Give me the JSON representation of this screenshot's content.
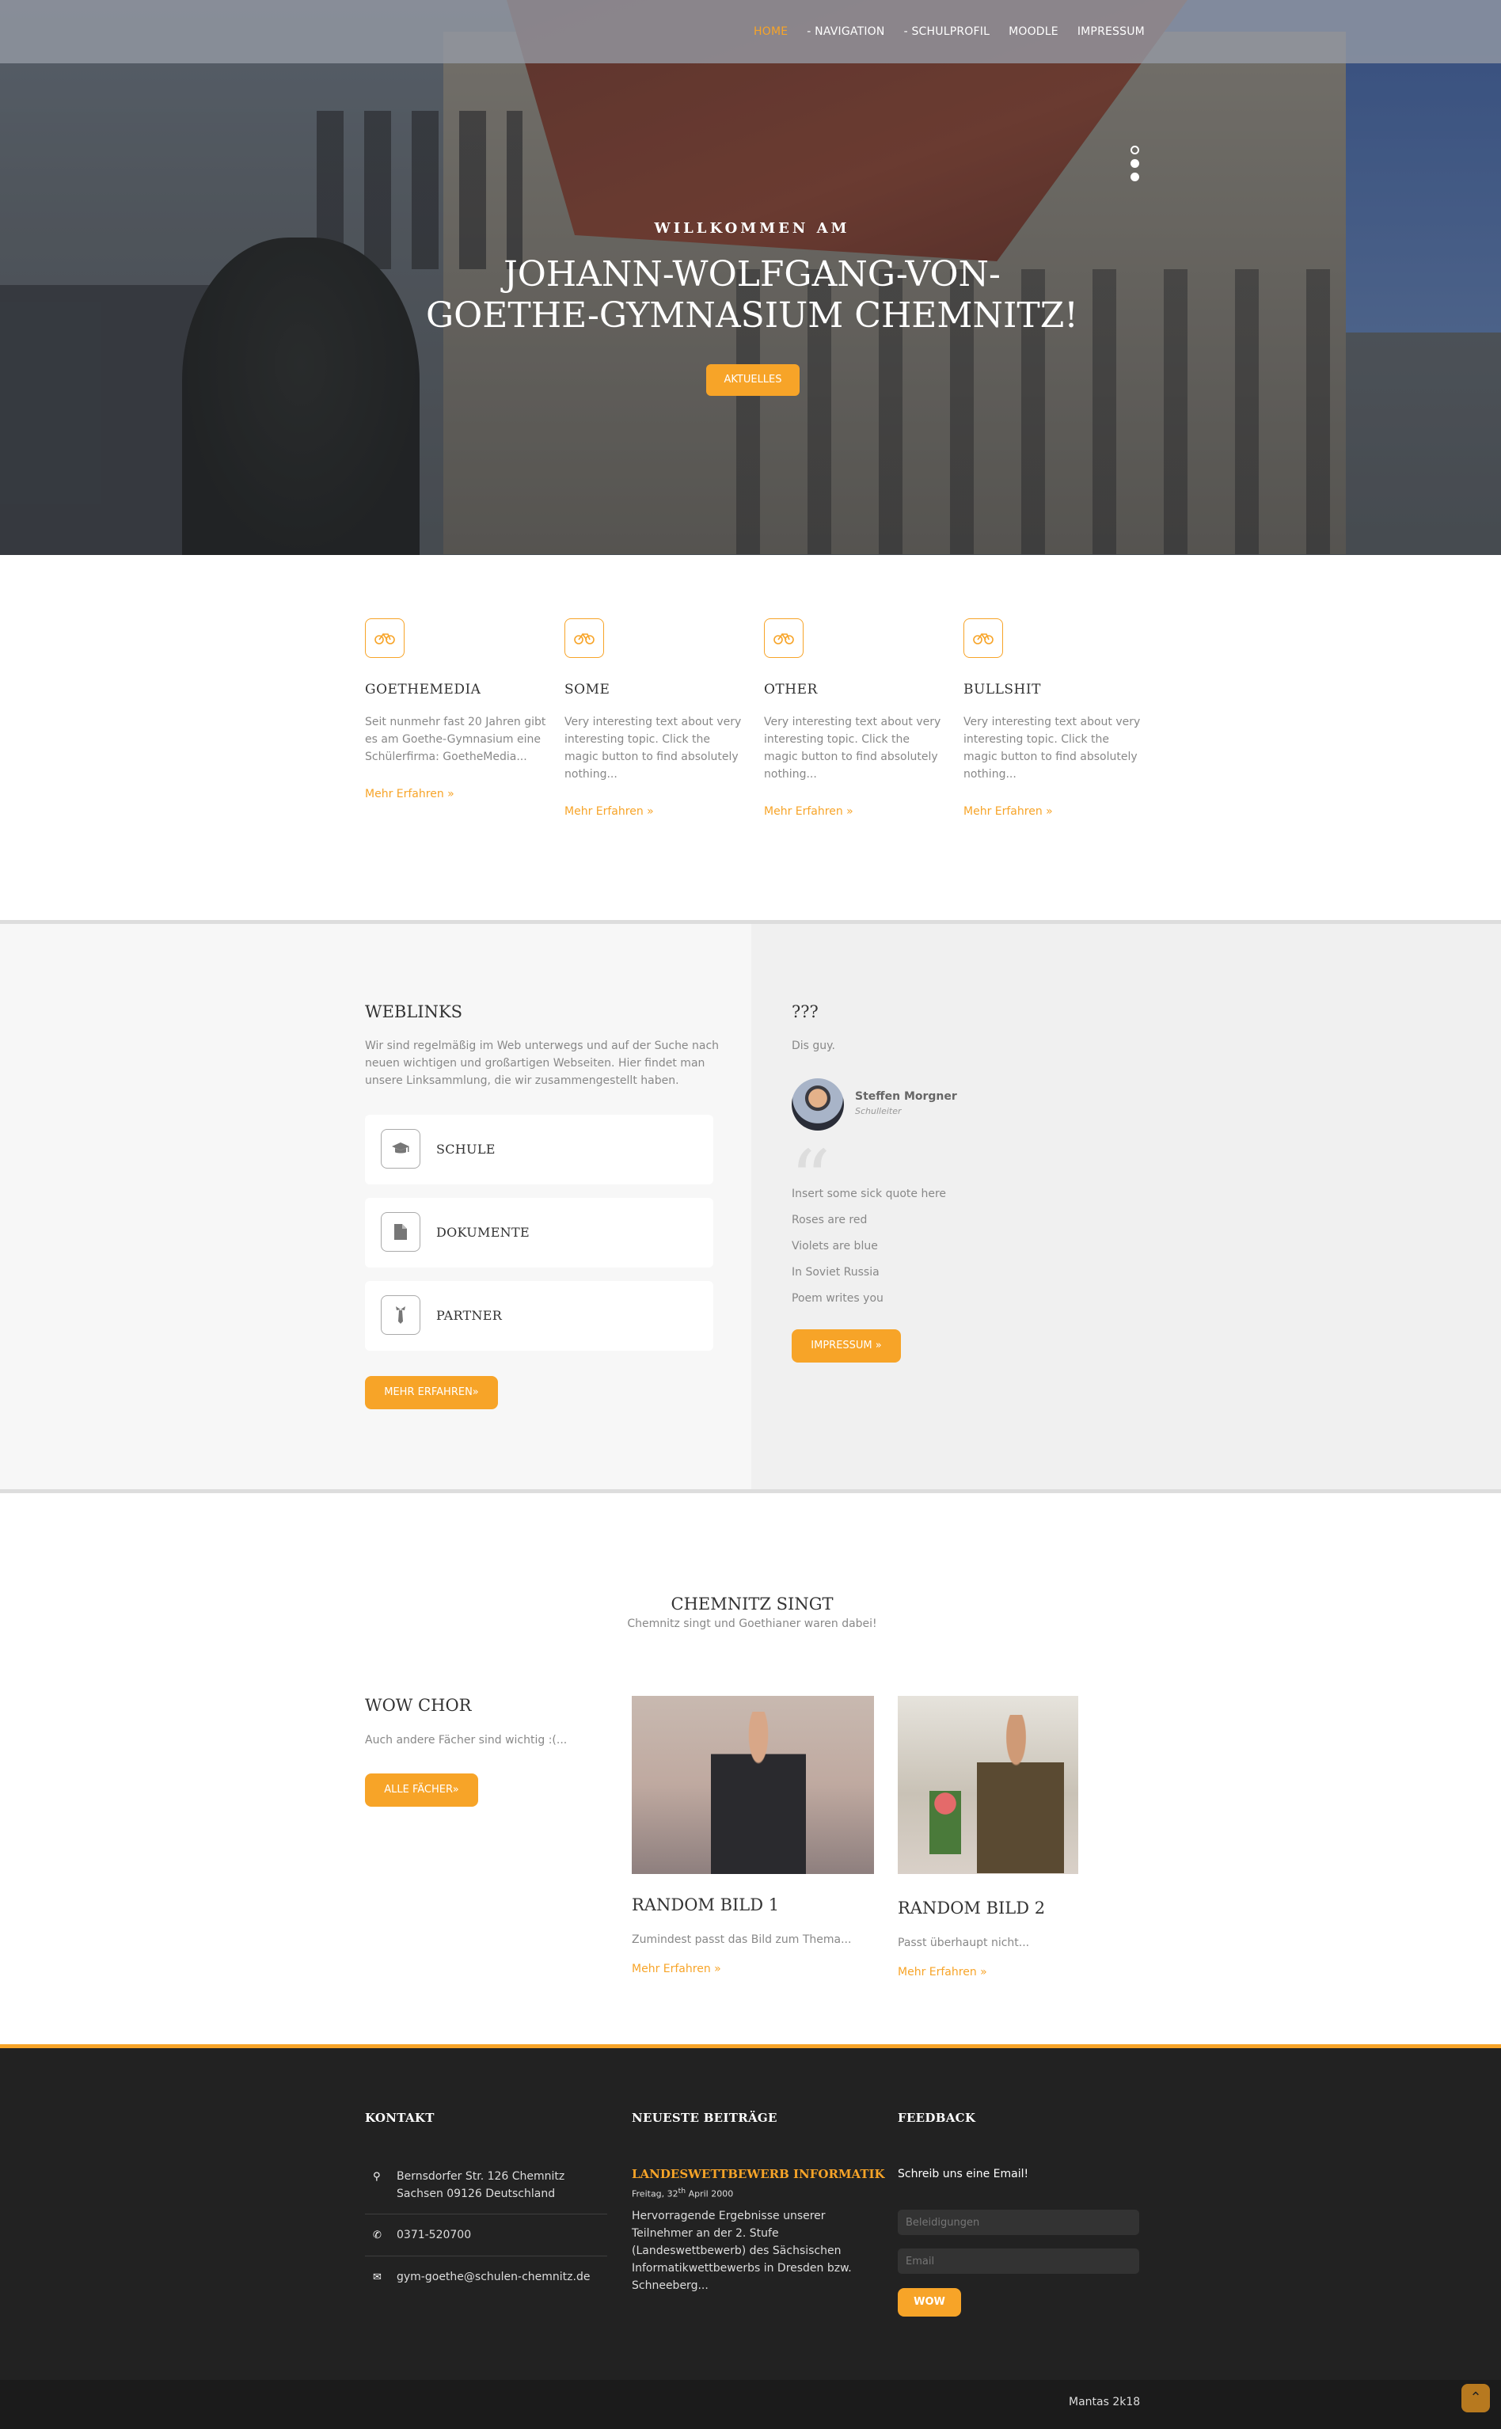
{
  "nav": {
    "items": [
      "HOME",
      "- NAVIGATION",
      "- SCHULPROFIL",
      "MOODLE",
      "IMPRESSUM"
    ],
    "active": "HOME"
  },
  "hero": {
    "kicker": "WILLKOMMEN AM",
    "title_line1": "JOHANN-WOLFGANG-VON-",
    "title_line2": "GOETHE-GYMNASIUM CHEMNITZ!",
    "button": "AKTUELLES",
    "slides": 3,
    "active_slide": 1
  },
  "features": [
    {
      "icon": "cycle-icon",
      "title": "GOETHEMEDIA",
      "text": "Seit nunmehr fast 20 Jahren gibt es am Goethe-Gymnasium eine Schülerfirma: GoetheMedia...",
      "link": "Mehr Erfahren »"
    },
    {
      "icon": "cycle-icon",
      "title": "SOME",
      "text": "Very interesting text about very interesting topic. Click the magic button to find absolutely nothing...",
      "link": "Mehr Erfahren »"
    },
    {
      "icon": "cycle-icon",
      "title": "OTHER",
      "text": "Very interesting text about very interesting topic. Click the magic button to find absolutely nothing...",
      "link": "Mehr Erfahren »"
    },
    {
      "icon": "cycle-icon",
      "title": "BULLSHIT",
      "text": "Very interesting text about very interesting topic. Click the magic button to find absolutely nothing...",
      "link": "Mehr Erfahren »"
    }
  ],
  "weblinks": {
    "title": "WEBLINKS",
    "text": "Wir sind regelmäßig im Web unterwegs und auf der Suche nach neuen wichtigen und großartigen Webseiten. Hier findet man unsere Linksammlung, die wir zusammengestellt haben.",
    "links": [
      {
        "icon": "graduation-cap-icon",
        "label": "SCHULE"
      },
      {
        "icon": "document-icon",
        "label": "DOKUMENTE"
      },
      {
        "icon": "tie-icon",
        "label": "PARTNER"
      }
    ],
    "button": "MEHR ERFAHREN»"
  },
  "quote": {
    "title": "???",
    "subtitle": "Dis guy.",
    "name": "Steffen Morgner",
    "role": "Schulleiter",
    "lines": [
      "Insert some sick quote here",
      "Roses are red",
      "Violets are blue",
      "In Soviet Russia",
      "Poem writes you"
    ],
    "button": "IMPRESSUM »"
  },
  "singt": {
    "title": "CHEMNITZ SINGT",
    "subtitle": "Chemnitz singt und Goethianer waren dabei!",
    "wow_title": "WOW CHOR",
    "wow_text": "Auch andere Fächer sind wichtig :(...",
    "wow_button": "ALLE FÄCHER»",
    "items": [
      {
        "title": "RANDOM BILD 1",
        "text": "Zumindest passt das Bild zum Thema...",
        "link": "Mehr Erfahren »"
      },
      {
        "title": "RANDOM BILD 2",
        "text": "Passt überhaupt nicht...",
        "link": "Mehr Erfahren »"
      }
    ]
  },
  "footer": {
    "kontakt_title": "KONTAKT",
    "address_line1": "Bernsdorfer Str. 126 Chemnitz",
    "address_line2": "Sachsen 09126 Deutschland",
    "phone": "0371-520700",
    "email": "gym-goethe@schulen-chemnitz.de",
    "news_title": "NEUESTE BEITRÄGE",
    "post_title": "LANDESWETTBEWERB INFORMATIK",
    "post_date_prefix": "Freitag, 32",
    "post_date_sup": "th",
    "post_date_suffix": " April 2000",
    "post_text": "Hervorragende Ergebnisse unserer Teilnehmer an der 2. Stufe (Landeswettbewerb) des Sächsischen Informatikwettbewerbs in Dresden bzw. Schneeberg...",
    "feedback_title": "FEEDBACK",
    "feedback_text": "Schreib uns eine Email!",
    "input1_placeholder": "Beleidigungen",
    "input2_placeholder": "Email",
    "submit": "WOW",
    "credit": "Mantas 2k18"
  },
  "colors": {
    "accent": "#f7a428",
    "footer_bg": "#222222"
  }
}
